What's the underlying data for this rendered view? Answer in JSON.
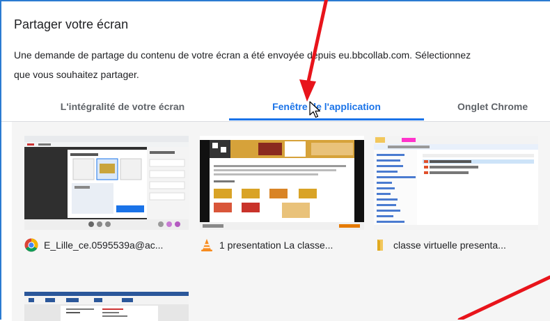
{
  "dialog": {
    "title": "Partager votre écran",
    "description_line1": "Une demande de partage du contenu de votre écran a été envoyée depuis eu.bbcollab.com. Sélectionnez",
    "description_line2": "que vous souhaitez partager."
  },
  "tabs": [
    {
      "label": "L'intégralité de votre écran",
      "active": false
    },
    {
      "label": "Fenêtre de l'application",
      "active": true
    },
    {
      "label": "Onglet Chrome",
      "active": false
    }
  ],
  "windows": [
    {
      "label": "E_Lille_ce.0595539a@ac...",
      "icon": "chrome-icon"
    },
    {
      "label": "1 presentation La classe...",
      "icon": "vlc-icon"
    },
    {
      "label": "classe virtuelle presenta...",
      "icon": "folder-icon"
    },
    {
      "label": "",
      "icon": "word-icon"
    }
  ],
  "colors": {
    "accent": "#1a73e8",
    "annotation_arrow": "#e8141b",
    "grid_background": "#f5f5f5"
  }
}
